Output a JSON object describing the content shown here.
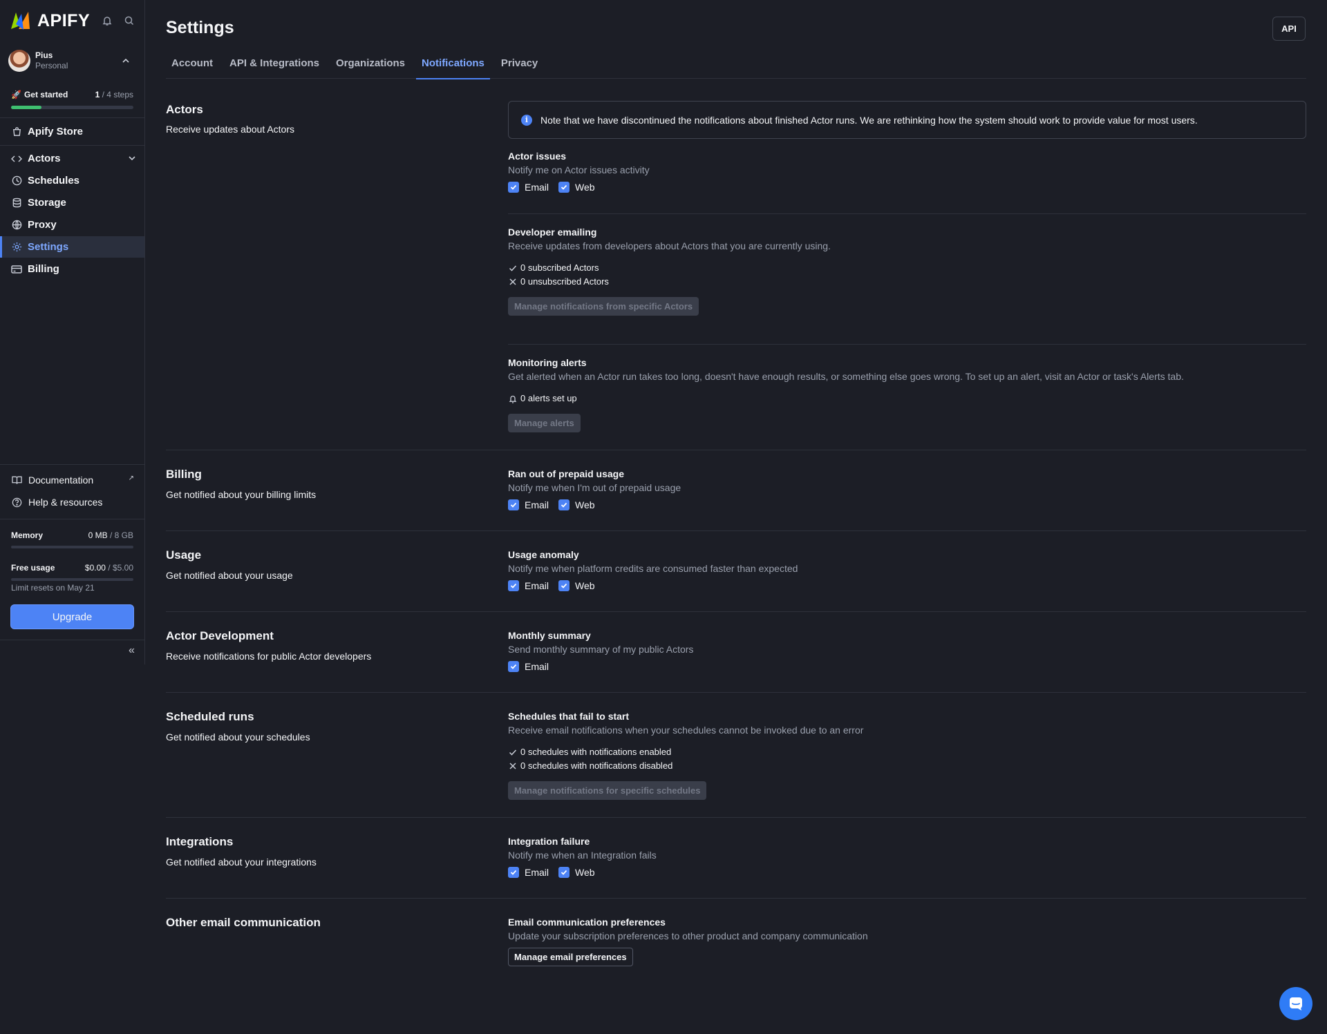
{
  "app": {
    "logo_text": "APIFY"
  },
  "user": {
    "name": "Pius",
    "account_type": "Personal"
  },
  "get_started": {
    "label": "Get started",
    "done": "1",
    "total": "/ 4 steps",
    "progress": 0.25
  },
  "nav": {
    "store": "Apify Store",
    "items": [
      {
        "label": "Actors",
        "icon": "code-icon"
      },
      {
        "label": "Schedules",
        "icon": "clock-icon"
      },
      {
        "label": "Storage",
        "icon": "database-icon"
      },
      {
        "label": "Proxy",
        "icon": "globe-icon"
      },
      {
        "label": "Settings",
        "icon": "gear-icon"
      },
      {
        "label": "Billing",
        "icon": "card-icon"
      }
    ],
    "active": "Settings"
  },
  "bottom_links": {
    "documentation": "Documentation",
    "help": "Help & resources"
  },
  "memory": {
    "label": "Memory",
    "used": "0 MB",
    "total": "/ 8 GB",
    "fraction": 0
  },
  "free_usage": {
    "label": "Free usage",
    "used": "$0.00",
    "total": "/ $5.00",
    "fraction": 0,
    "note": "Limit resets on May 21"
  },
  "upgrade_label": "Upgrade",
  "header": {
    "title": "Settings",
    "api_label": "API"
  },
  "tabs": [
    "Account",
    "API & Integrations",
    "Organizations",
    "Notifications",
    "Privacy"
  ],
  "active_tab": "Notifications",
  "sections": {
    "actors": {
      "title": "Actors",
      "desc": "Receive updates about Actors",
      "note": "Note that we have discontinued the notifications about finished Actor runs. We are rethinking how the system should work to provide value for most users.",
      "issues": {
        "title": "Actor issues",
        "desc": "Notify me on Actor issues activity",
        "email": "Email",
        "web": "Web"
      },
      "dev_emailing": {
        "title": "Developer emailing",
        "desc": "Receive updates from developers about Actors that you are currently using.",
        "subscribed": "0 subscribed Actors",
        "unsubscribed": "0 unsubscribed Actors",
        "button": "Manage notifications from specific Actors"
      },
      "monitoring": {
        "title": "Monitoring alerts",
        "desc": "Get alerted when an Actor run takes too long, doesn't have enough results, or something else goes wrong. To set up an alert, visit an Actor or task's Alerts tab.",
        "alerts": "0 alerts set up",
        "button": "Manage alerts"
      }
    },
    "billing": {
      "title": "Billing",
      "desc": "Get notified about your billing limits",
      "item": {
        "title": "Ran out of prepaid usage",
        "desc": "Notify me when I'm out of prepaid usage",
        "email": "Email",
        "web": "Web"
      }
    },
    "usage": {
      "title": "Usage",
      "desc": "Get notified about your usage",
      "item": {
        "title": "Usage anomaly",
        "desc": "Notify me when platform credits are consumed faster than expected",
        "email": "Email",
        "web": "Web"
      }
    },
    "actor_dev": {
      "title": "Actor Development",
      "desc": "Receive notifications for public Actor developers",
      "item": {
        "title": "Monthly summary",
        "desc": "Send monthly summary of my public Actors",
        "email": "Email"
      }
    },
    "scheduled": {
      "title": "Scheduled runs",
      "desc": "Get notified about your schedules",
      "item": {
        "title": "Schedules that fail to start",
        "desc": "Receive email notifications when your schedules cannot be invoked due to an error",
        "enabled": "0 schedules with notifications enabled",
        "disabled": "0 schedules with notifications disabled",
        "button": "Manage notifications for specific schedules"
      }
    },
    "integrations": {
      "title": "Integrations",
      "desc": "Get notified about your integrations",
      "item": {
        "title": "Integration failure",
        "desc": "Notify me when an Integration fails",
        "email": "Email",
        "web": "Web"
      }
    },
    "other_email": {
      "title": "Other email communication",
      "item": {
        "title": "Email communication preferences",
        "desc": "Update your subscription preferences to other product and company communication",
        "button": "Manage email preferences"
      }
    }
  },
  "colors": {
    "accent": "#4d83f5",
    "background": "#1c1e26",
    "progress_green": "#3fbf70"
  }
}
